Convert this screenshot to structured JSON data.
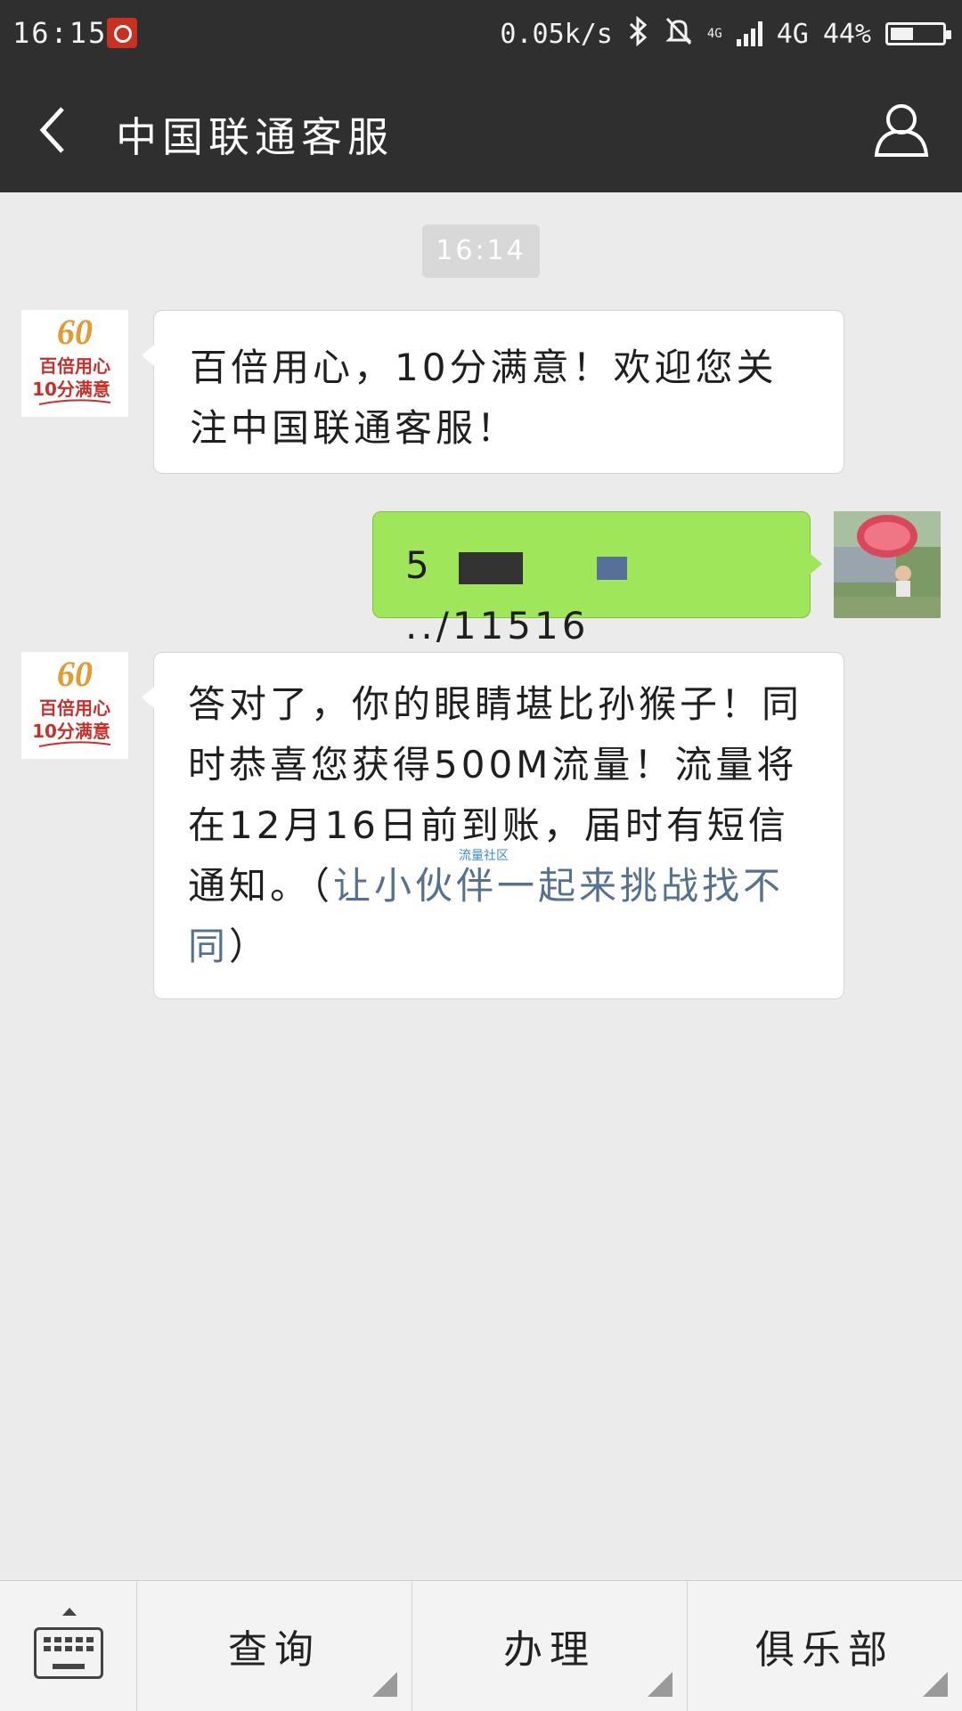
{
  "status_bar": {
    "time": "16:15",
    "net_speed": "0.05k/s",
    "network_type": "4G",
    "network_small": "4G",
    "battery_percent": "44%",
    "battery_level": 0.44,
    "icons": [
      "bluetooth-icon",
      "mute-bell-icon",
      "signal-icon",
      "battery-icon"
    ]
  },
  "header": {
    "title": "中国联通客服",
    "back_icon": "chevron-left-icon",
    "profile_icon": "person-icon"
  },
  "chat": {
    "timestamp": "16:14",
    "messages": [
      {
        "side": "in",
        "sender_avatar": {
          "line1": "60",
          "line2": "百倍用心",
          "line3": "10分满意"
        },
        "text": "百倍用心，10分满意！欢迎您关注中国联通客服！"
      },
      {
        "side": "out",
        "text_prefix": "5",
        "text_suffix": "../11516"
      },
      {
        "side": "in",
        "sender_avatar": {
          "line1": "60",
          "line2": "百倍用心",
          "line3": "10分满意"
        },
        "text_main": "答对了，你的眼睛堪比孙猴子！同时恭喜您获得500M流量！流量将在12月16日前到账，届时有短信通知。（",
        "text_link": "让小伙伴一起来挑战找不同",
        "text_end": "）",
        "watermark": "流量社区"
      }
    ]
  },
  "bottom_menu": {
    "keyboard_icon": "keyboard-icon",
    "items": [
      {
        "label": "查询"
      },
      {
        "label": "办理"
      },
      {
        "label": "俱乐部"
      }
    ]
  },
  "colors": {
    "header_bg": "#2f2f2f",
    "chat_bg": "#ebebeb",
    "bubble_out": "#9fe65a",
    "bubble_in": "#ffffff",
    "link": "#56708f"
  }
}
